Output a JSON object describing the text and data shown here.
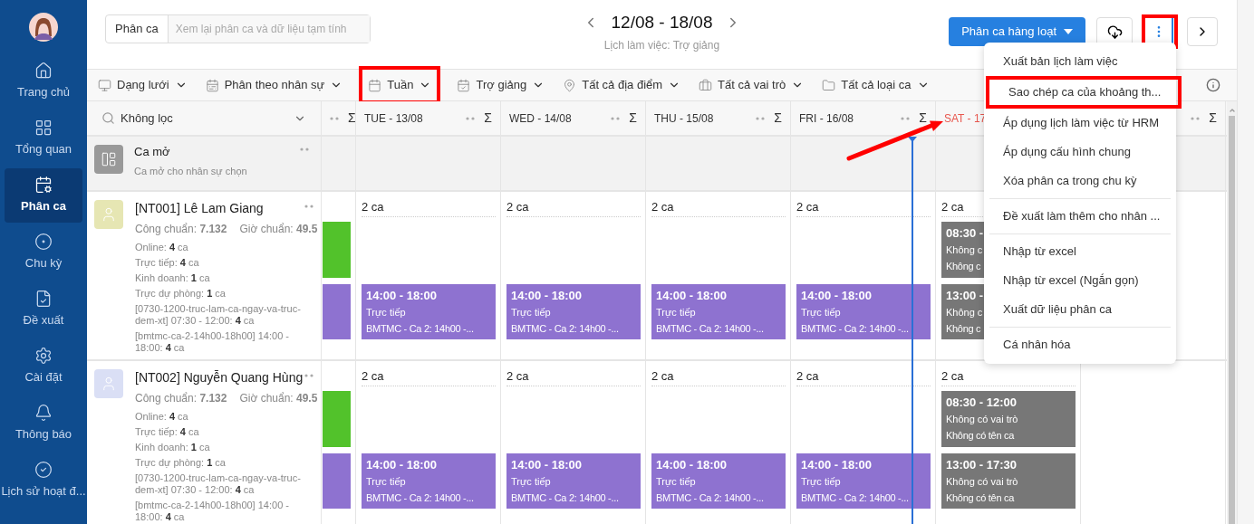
{
  "sidebar": {
    "items": [
      {
        "label": "Trang chủ",
        "selected": false
      },
      {
        "label": "Tổng quan",
        "selected": false
      },
      {
        "label": "Phân ca",
        "selected": true
      },
      {
        "label": "Chu kỳ",
        "selected": false
      },
      {
        "label": "Đề xuất",
        "selected": false
      },
      {
        "label": "Cài đặt",
        "selected": false
      },
      {
        "label": "Thông báo",
        "selected": false
      },
      {
        "label": "Lịch sử hoạt đ...",
        "selected": false
      }
    ]
  },
  "header": {
    "module_tab": "Phân ca",
    "review_placeholder": "Xem lại phân ca và dữ liệu tạm tính",
    "date_range": "12/08 - 18/08",
    "subtitle": "Lịch làm việc: Trợ giảng",
    "bulk_button": "Phân ca hàng loạt",
    "more_highlighted": true
  },
  "toolbar": {
    "filters": [
      {
        "label": "Dạng lưới",
        "highlighted": false
      },
      {
        "label": "Phân theo nhân sự",
        "highlighted": false
      },
      {
        "label": "Tuần",
        "highlighted": true
      },
      {
        "label": "Trợ giảng",
        "highlighted": false
      },
      {
        "label": "Tất cả địa điểm",
        "highlighted": false
      },
      {
        "label": "Tất cả vai trò",
        "highlighted": false
      },
      {
        "label": "Tất cả loại ca",
        "highlighted": false
      }
    ]
  },
  "grid": {
    "filter_label": "Không lọc",
    "current_time_line": true,
    "days": [
      {
        "sum": "Σ"
      },
      {
        "label": "TUE - 13/08",
        "weekend": false,
        "sum": "Σ"
      },
      {
        "label": "WED - 14/08",
        "weekend": false,
        "sum": "Σ"
      },
      {
        "label": "THU - 15/08",
        "weekend": false,
        "sum": "Σ"
      },
      {
        "label": "FRI - 16/08",
        "weekend": false,
        "sum": "Σ"
      },
      {
        "label": "SAT - 17",
        "weekend": true
      },
      {
        "sum": "Σ"
      }
    ],
    "open_shift": {
      "title": "Ca mở",
      "subtitle": "Ca mở cho nhân sự chọn"
    },
    "employees": [
      {
        "name": "[NT001] Lê Lam Giang",
        "color": "#e6e6b3",
        "standard_work": "Công chuẩn: **7.132**",
        "standard_hours": "Giờ chuẩn: **49.5**",
        "stats": [
          "Online: **4** ca",
          "Trực tiếp: **4** ca",
          "Kinh doanh: **1** ca",
          "Trực dự phòng: **1** ca",
          "[0730-1200-truc-lam-ca-ngay-va-truc-dem-xt] 07:30 - 12:00: **4** ca",
          "[bmtmc-ca-2-14h00-18h00] 14:00 - 18:00: **4** ca"
        ],
        "cells": [
          {
            "morning_shift": {
              "color": "#52c22b"
            },
            "afternoon_shift": {
              "color": "#8e72d0"
            }
          },
          {
            "count": "2 ca",
            "afternoon_shift": {
              "color": "#8e72d0",
              "time": "14:00 - 18:00",
              "role": "Trực tiếp",
              "name": "BMTMC - Ca 2: 14h00 -..."
            }
          },
          {
            "count": "2 ca",
            "afternoon_shift": {
              "color": "#8e72d0",
              "time": "14:00 - 18:00",
              "role": "Trực tiếp",
              "name": "BMTMC - Ca 2: 14h00 -..."
            }
          },
          {
            "count": "2 ca",
            "afternoon_shift": {
              "color": "#8e72d0",
              "time": "14:00 - 18:00",
              "role": "Trực tiếp",
              "name": "BMTMC - Ca 2: 14h00 -..."
            }
          },
          {
            "count": "2 ca",
            "afternoon_shift": {
              "color": "#8e72d0",
              "time": "14:00 - 18:00",
              "role": "Trực tiếp",
              "name": "BMTMC - Ca 2: 14h00 -..."
            }
          },
          {
            "count": "2 ca",
            "morning_shift": {
              "color": "#777777",
              "time": "08:30 -",
              "role": "Không c",
              "name": "Không c"
            },
            "afternoon_shift": {
              "color": "#777777",
              "time": "13:00 -",
              "role": "Không c",
              "name": "Không c"
            }
          }
        ]
      },
      {
        "name": "[NT002] Nguyễn Quang Hùng",
        "color": "#dadff5",
        "standard_work": "Công chuẩn: **7.132**",
        "standard_hours": "Giờ chuẩn: **49.5**",
        "stats": [
          "Online: **4** ca",
          "Trực tiếp: **4** ca",
          "Kinh doanh: **1** ca",
          "Trực dự phòng: **1** ca",
          "[0730-1200-truc-lam-ca-ngay-va-truc-dem-xt] 07:30 - 12:00: **4** ca",
          "[bmtmc-ca-2-14h00-18h00] 14:00 - 18:00: **4** ca"
        ],
        "cells": [
          {
            "morning_shift": {
              "color": "#52c22b"
            },
            "afternoon_shift": {
              "color": "#8e72d0"
            }
          },
          {
            "count": "2 ca",
            "afternoon_shift": {
              "color": "#8e72d0",
              "time": "14:00 - 18:00",
              "role": "Trực tiếp",
              "name": "BMTMC - Ca 2: 14h00 -..."
            }
          },
          {
            "count": "2 ca",
            "afternoon_shift": {
              "color": "#8e72d0",
              "time": "14:00 - 18:00",
              "role": "Trực tiếp",
              "name": "BMTMC - Ca 2: 14h00 -..."
            }
          },
          {
            "count": "2 ca",
            "afternoon_shift": {
              "color": "#8e72d0",
              "time": "14:00 - 18:00",
              "role": "Trực tiếp",
              "name": "BMTMC - Ca 2: 14h00 -..."
            }
          },
          {
            "count": "2 ca",
            "afternoon_shift": {
              "color": "#8e72d0",
              "time": "14:00 - 18:00",
              "role": "Trực tiếp",
              "name": "BMTMC - Ca 2: 14h00 -..."
            }
          },
          {
            "count": "2 ca",
            "morning_shift": {
              "color": "#777777",
              "time": "08:30 - 12:00",
              "role": "Không có vai trò",
              "name": "Không có tên ca"
            },
            "afternoon_shift": {
              "color": "#777777",
              "time": "13:00 - 17:30",
              "role": "Không có vai trò",
              "name": "Không có tên ca"
            }
          }
        ]
      }
    ]
  },
  "menu": {
    "groups": [
      [
        {
          "label": "Xuất bản lịch làm việc",
          "highlighted": false
        },
        {
          "label": "Sao chép ca của khoảng th...",
          "highlighted": true
        },
        {
          "label": "Áp dụng lịch làm việc từ HRM",
          "highlighted": false
        },
        {
          "label": "Áp dụng cấu hình chung",
          "highlighted": false
        },
        {
          "label": "Xóa phân ca trong chu kỳ",
          "highlighted": false
        }
      ],
      [
        {
          "label": "Đề xuất làm thêm cho nhân ...",
          "highlighted": false
        }
      ],
      [
        {
          "label": "Nhập từ excel",
          "highlighted": false
        },
        {
          "label": "Nhập từ excel (Ngắn gọn)",
          "highlighted": false
        },
        {
          "label": "Xuất dữ liệu phân ca",
          "highlighted": false
        }
      ],
      [
        {
          "label": "Cá nhân hóa",
          "highlighted": false
        }
      ]
    ]
  },
  "annotation_arrow": true
}
